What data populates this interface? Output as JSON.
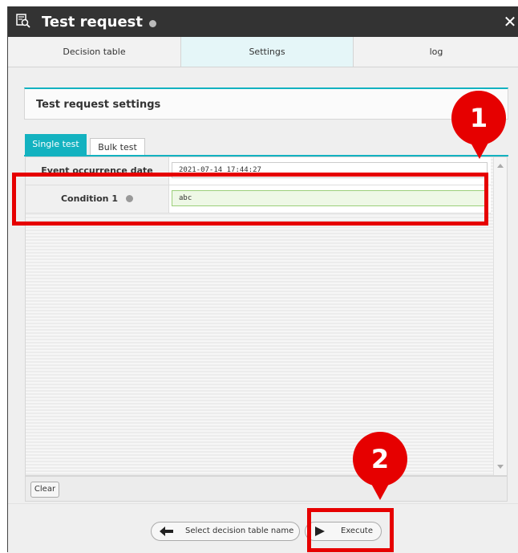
{
  "window": {
    "title": "Test request",
    "close_icon": "close-icon"
  },
  "tabs": [
    {
      "label": "Decision table"
    },
    {
      "label": "Settings"
    },
    {
      "label": "log"
    }
  ],
  "settings": {
    "panel_title": "Test request settings",
    "subtabs": [
      {
        "label": "Single test"
      },
      {
        "label": "Bulk test"
      }
    ],
    "rows": [
      {
        "label": "Event occurrence date",
        "value": "2021-07-14 17:44:27"
      },
      {
        "label": "Condition 1",
        "value": "abc"
      }
    ]
  },
  "footer": {
    "clear_label": "Clear"
  },
  "buttons": {
    "back_label": "Select decision table name",
    "execute_label": "Execute"
  },
  "annotations": {
    "callout_1": "1",
    "callout_2": "2"
  },
  "colors": {
    "accent": "#13b2c0",
    "annotation": "#e60000",
    "titlebar": "#333333"
  }
}
